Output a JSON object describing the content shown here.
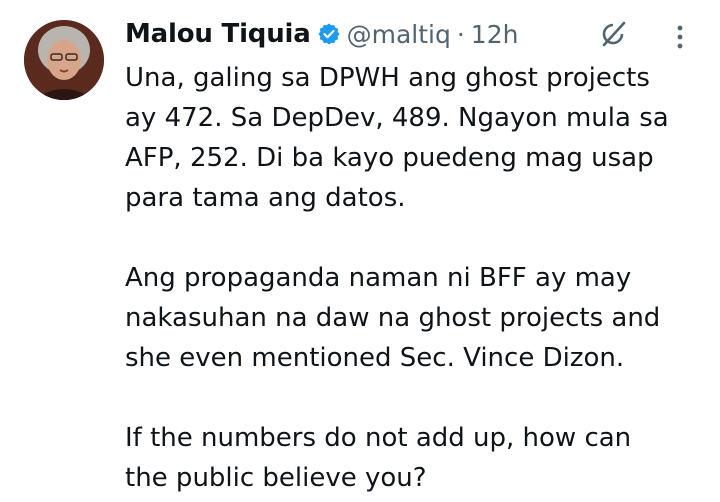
{
  "author": {
    "name": "Malou Tiquia",
    "handle": "@maltiq",
    "separator": "·",
    "time": "12h",
    "verified": true,
    "verified_color": "#1d9bf0"
  },
  "icons": {
    "verified": "verified-badge-icon",
    "grok": "grok-icon",
    "more": "more-vertical-icon"
  },
  "tweet": {
    "paragraph1": [
      "Una, galing sa DPWH ang ghost projects",
      "ay 472. Sa DepDev, 489. Ngayon mula sa",
      "AFP, 252. Di ba kayo puedeng mag usap",
      "para tama ang datos."
    ],
    "paragraph2": [
      "Ang propaganda naman ni BFF ay may",
      "nakasuhan na daw na ghost projects and",
      "she even mentioned Sec. Vince Dizon."
    ],
    "paragraph3": [
      "If the numbers do not add up, how can",
      "the public believe you?"
    ]
  }
}
